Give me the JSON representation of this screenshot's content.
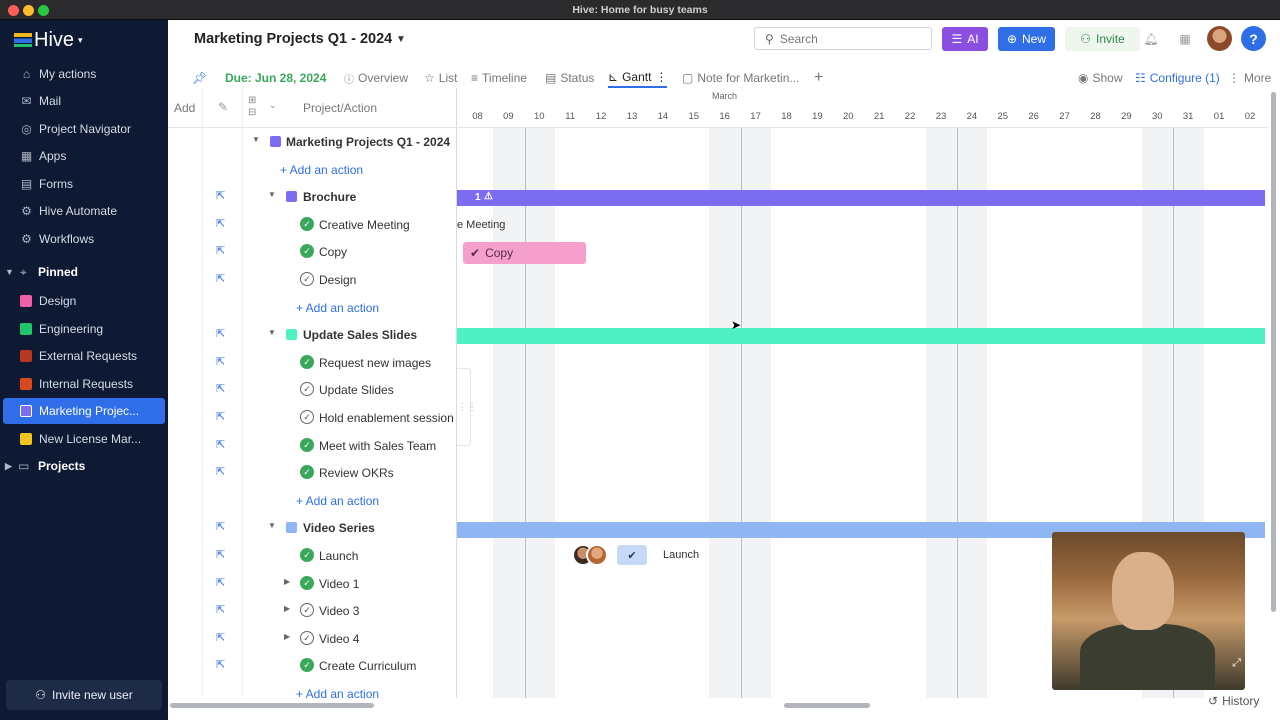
{
  "window": {
    "title": "Hive: Home for busy teams"
  },
  "sidebar": {
    "logo": "Hive",
    "nav": [
      {
        "label": "My actions",
        "icon": "home-icon"
      },
      {
        "label": "Mail",
        "icon": "mail-icon"
      },
      {
        "label": "Project Navigator",
        "icon": "compass-icon"
      },
      {
        "label": "Apps",
        "icon": "apps-grid-icon"
      },
      {
        "label": "Forms",
        "icon": "forms-icon"
      },
      {
        "label": "Hive Automate",
        "icon": "automate-icon"
      },
      {
        "label": "Workflows",
        "icon": "workflows-icon"
      }
    ],
    "pinned_label": "Pinned",
    "pinned": [
      {
        "label": "Design",
        "color": "#f25fa9"
      },
      {
        "label": "Engineering",
        "color": "#1fc46b"
      },
      {
        "label": "External Requests",
        "color": "#b8371f"
      },
      {
        "label": "Internal Requests",
        "color": "#d9461f"
      },
      {
        "label": "Marketing Projec...",
        "color": "#7b6cf2"
      },
      {
        "label": "New License Mar...",
        "color": "#f2c41f"
      }
    ],
    "projects_label": "Projects",
    "invite_label": "Invite new user"
  },
  "header": {
    "project_title": "Marketing Projects Q1 - 2024",
    "search_placeholder": "Search",
    "ai_label": "AI",
    "new_label": "New",
    "invite_label": "Invite",
    "help_label": "?"
  },
  "tabs": {
    "due": "Due: Jun 28, 2024",
    "items": [
      {
        "label": "Overview",
        "icon": "i"
      },
      {
        "label": "List",
        "icon": "☆"
      },
      {
        "label": "Timeline",
        "icon": "≡"
      },
      {
        "label": "Status",
        "icon": "▤"
      },
      {
        "label": "Gantt",
        "icon": "⊾"
      },
      {
        "label": "Note for Marketin...",
        "icon": "▢"
      }
    ],
    "show": "Show",
    "configure": "Configure (1)",
    "more": "More"
  },
  "gantt": {
    "col_add": "Add",
    "col_project": "Project/Action",
    "rows": [
      {
        "type": "top",
        "label": "Marketing Projects Q1 - 2024",
        "color": "#7b6cf2"
      },
      {
        "type": "add",
        "label": "+ Add an action"
      },
      {
        "type": "group",
        "label": "Brochure",
        "color": "#7b6cf2"
      },
      {
        "type": "task",
        "label": "Creative Meeting",
        "done": true
      },
      {
        "type": "task",
        "label": "Copy",
        "done": true
      },
      {
        "type": "task",
        "label": "Design",
        "done": false
      },
      {
        "type": "add",
        "label": "+ Add an action"
      },
      {
        "type": "group",
        "label": "Update Sales Slides",
        "color": "#4ff0c2"
      },
      {
        "type": "task",
        "label": "Request new images",
        "done": true
      },
      {
        "type": "task",
        "label": "Update Slides",
        "done": false
      },
      {
        "type": "task",
        "label": "Hold enablement session",
        "done": false
      },
      {
        "type": "task",
        "label": "Meet with Sales Team",
        "done": true
      },
      {
        "type": "task",
        "label": "Review OKRs",
        "done": true
      },
      {
        "type": "add",
        "label": "+ Add an action"
      },
      {
        "type": "group",
        "label": "Video Series",
        "color": "#8fb5f2"
      },
      {
        "type": "task",
        "label": "Launch",
        "done": true
      },
      {
        "type": "task",
        "label": "Video 1",
        "done": true,
        "expandable": true
      },
      {
        "type": "task",
        "label": "Video 3",
        "done": false,
        "expandable": true
      },
      {
        "type": "task",
        "label": "Video 4",
        "done": false,
        "expandable": true
      },
      {
        "type": "task",
        "label": "Create Curriculum",
        "done": true
      },
      {
        "type": "add",
        "label": "+ Add an action"
      }
    ],
    "month": "March",
    "days": [
      "08",
      "09",
      "10",
      "11",
      "12",
      "13",
      "14",
      "15",
      "16",
      "17",
      "18",
      "19",
      "20",
      "21",
      "22",
      "23",
      "24",
      "25",
      "26",
      "27",
      "28",
      "29",
      "30",
      "31",
      "01",
      "02"
    ],
    "weekend_days": [
      "09",
      "10",
      "16",
      "17",
      "23",
      "24",
      "30",
      "31"
    ],
    "brochure_badge": "1",
    "meeting_label": "e Meeting",
    "copy_label": "Copy",
    "launch_label": "Launch"
  },
  "footer": {
    "history": "History"
  }
}
